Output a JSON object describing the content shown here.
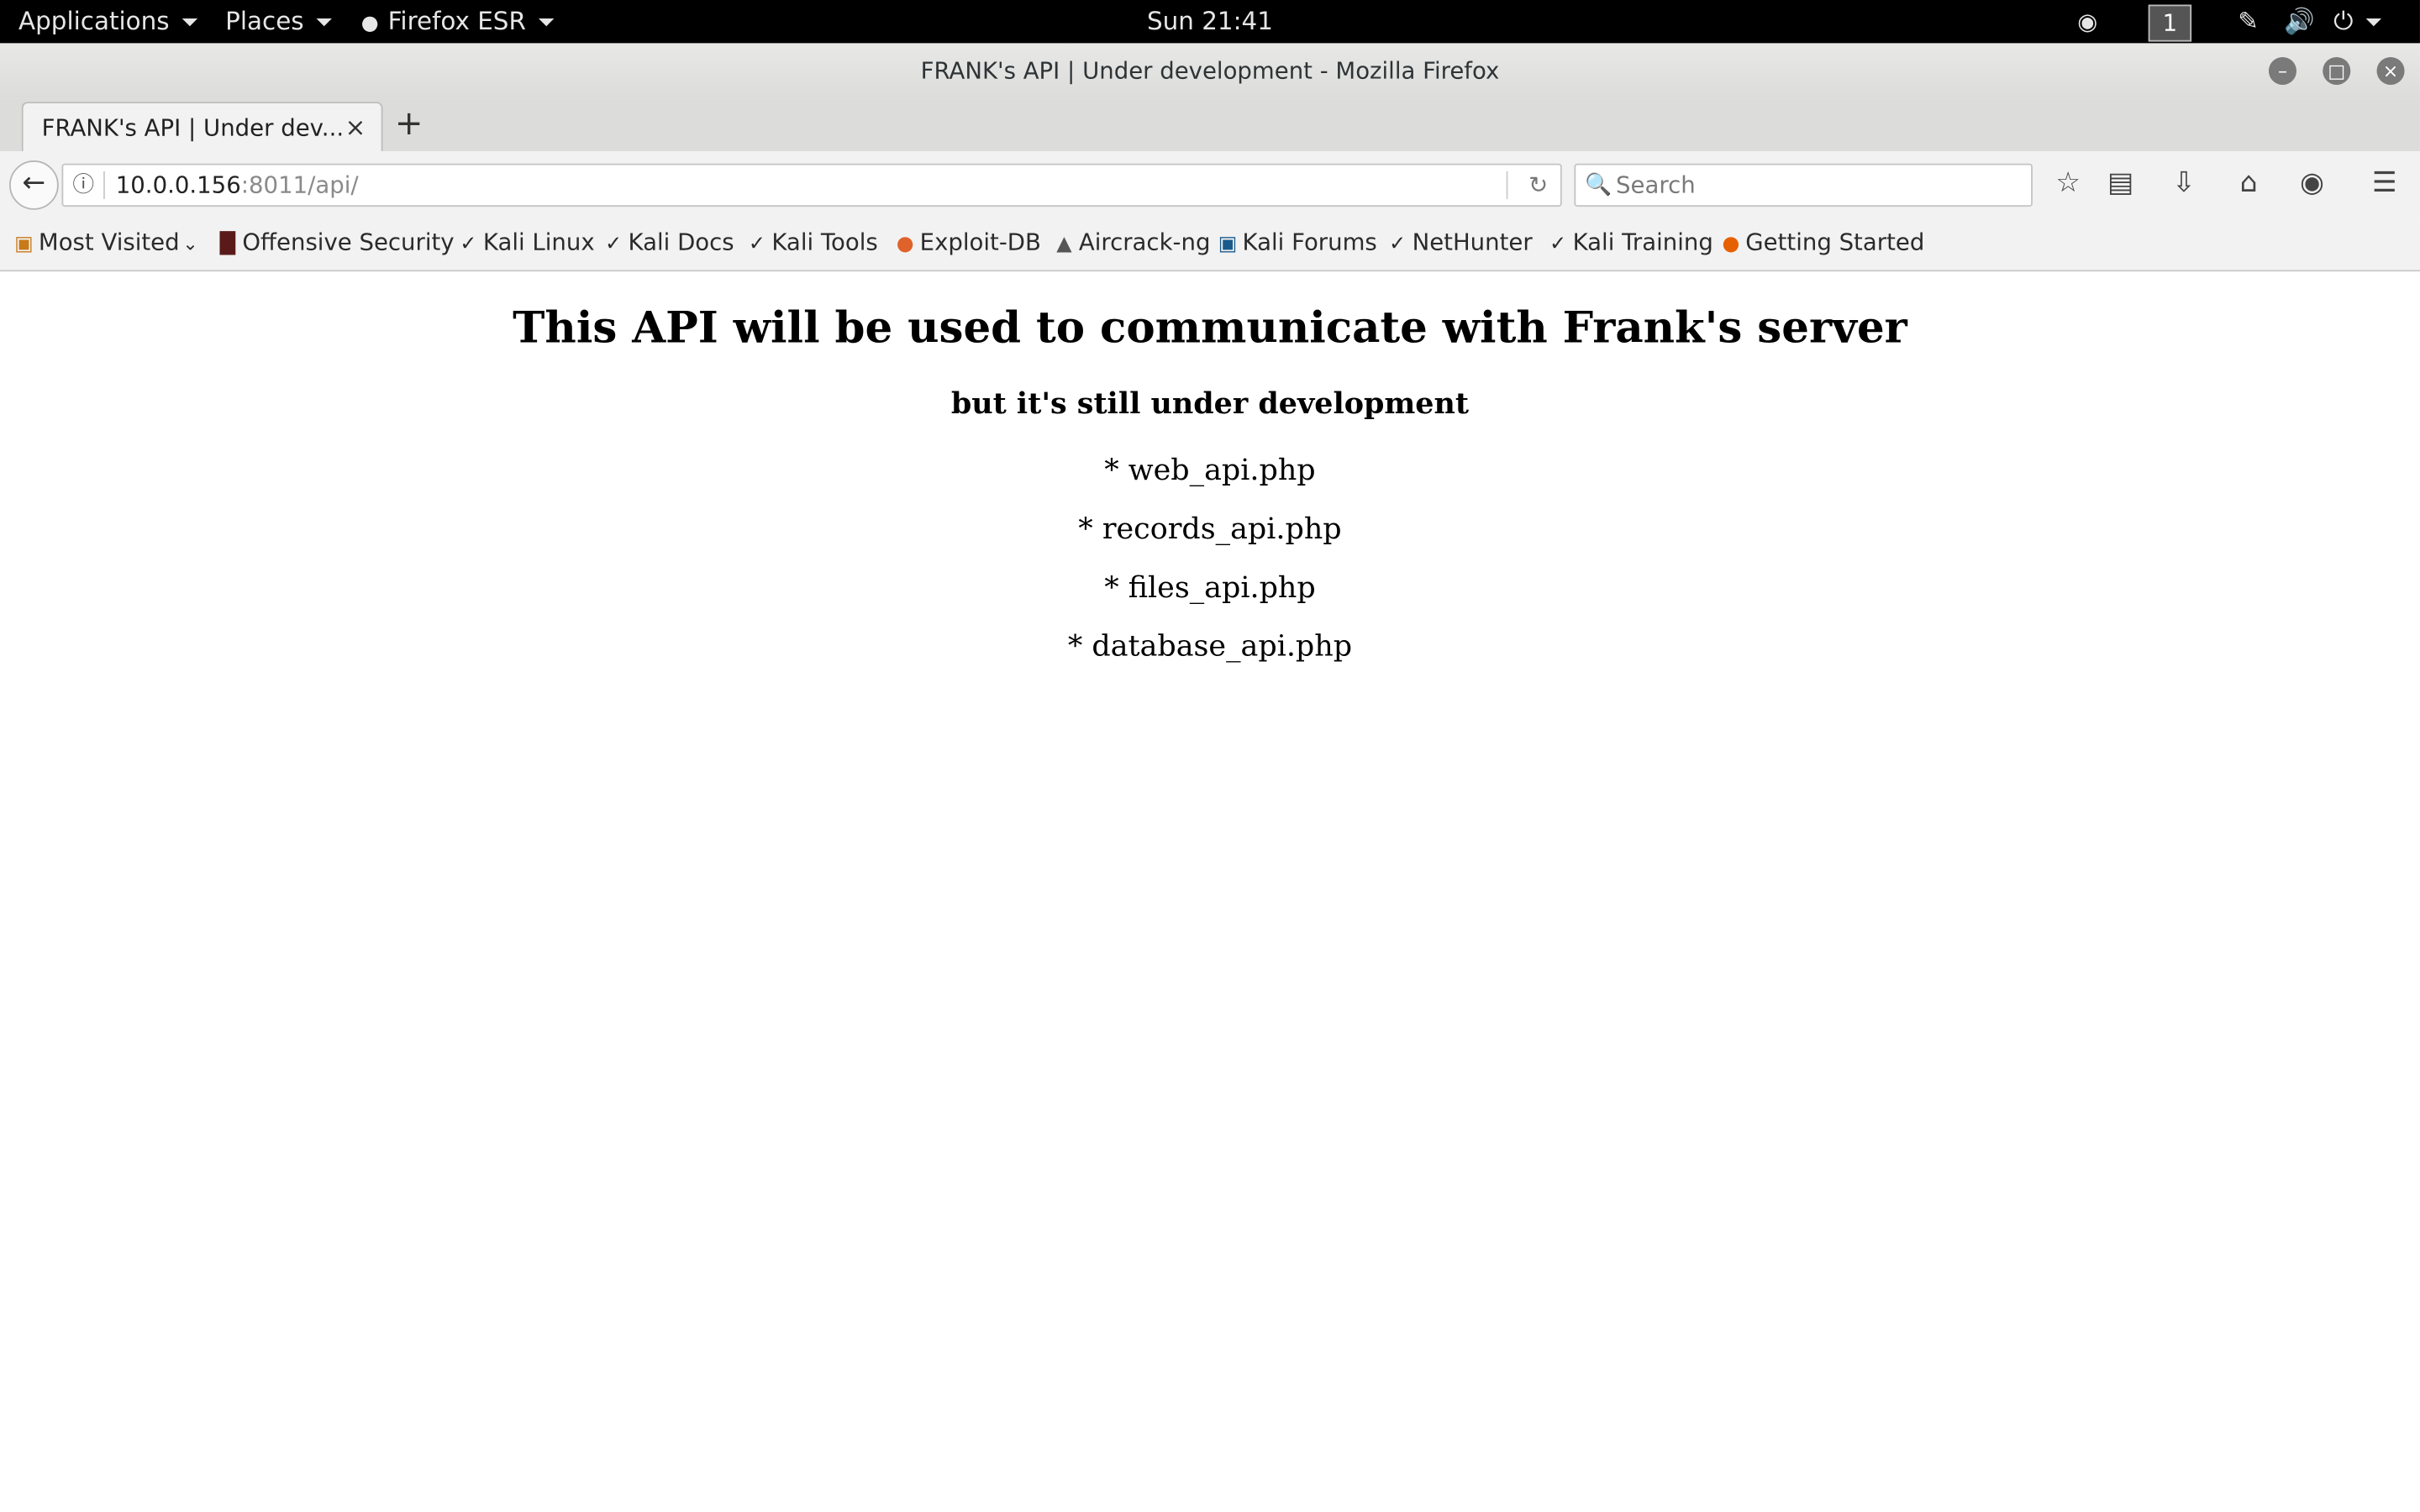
{
  "topbar": {
    "applications": "Applications",
    "places": "Places",
    "firefox_menu": "Firefox ESR",
    "clock": "Sun 21:41",
    "workspace": "1"
  },
  "window": {
    "title": "FRANK's API | Under development - Mozilla Firefox"
  },
  "tabs": [
    {
      "label": "FRANK's API | Under dev...",
      "close": "×"
    }
  ],
  "newtab": "+",
  "urlbar": {
    "host": "10.0.0.156",
    "rest": ":8011/api/"
  },
  "search": {
    "placeholder": "Search"
  },
  "bookmarks": [
    {
      "label": "Most Visited",
      "icon": "folder-icon"
    },
    {
      "label": "Offensive Security",
      "icon": "offsec-icon"
    },
    {
      "label": "Kali Linux",
      "icon": "kali-dragon-icon"
    },
    {
      "label": "Kali Docs",
      "icon": "kali-dragon-icon"
    },
    {
      "label": "Kali Tools",
      "icon": "kali-dragon-icon"
    },
    {
      "label": "Exploit-DB",
      "icon": "exploitdb-icon"
    },
    {
      "label": "Aircrack-ng",
      "icon": "aircrack-icon"
    },
    {
      "label": "Kali Forums",
      "icon": "kali-forums-icon"
    },
    {
      "label": "NetHunter",
      "icon": "kali-dragon-icon"
    },
    {
      "label": "Kali Training",
      "icon": "kali-dragon-icon"
    },
    {
      "label": "Getting Started",
      "icon": "firefox-icon"
    }
  ],
  "page": {
    "heading": "This API will be used to communicate with Frank's server",
    "subheading": "but it's still under development",
    "items": [
      "* web_api.php",
      "* records_api.php",
      "* files_api.php",
      "* database_api.php"
    ]
  }
}
